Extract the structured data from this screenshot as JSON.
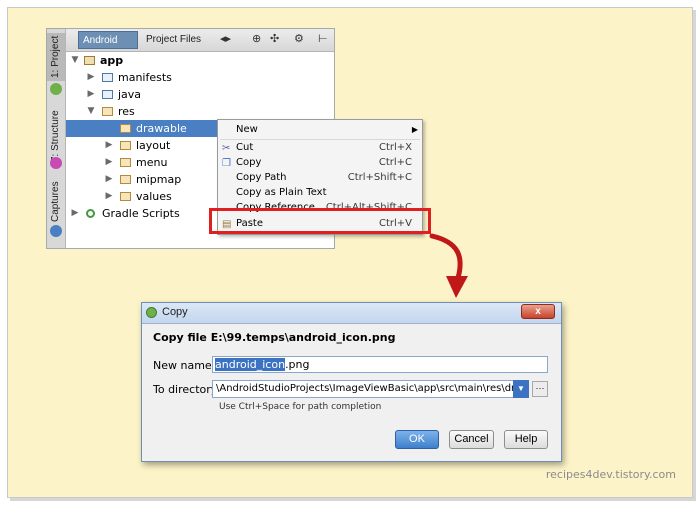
{
  "ide": {
    "vtabs": [
      "1: Project",
      "7: Structure",
      "Captures"
    ],
    "toolbar_tabs": [
      "Android",
      "Project Files"
    ],
    "tree": [
      {
        "label": "app",
        "bold": true
      },
      {
        "label": "manifests"
      },
      {
        "label": "java"
      },
      {
        "label": "res"
      },
      {
        "label": "drawable",
        "selected": true
      },
      {
        "label": "layout"
      },
      {
        "label": "menu"
      },
      {
        "label": "mipmap"
      },
      {
        "label": "values"
      },
      {
        "label": "Gradle Scripts"
      }
    ]
  },
  "context_menu": [
    {
      "label": "New",
      "shortcut": ""
    },
    {
      "label": "Cut",
      "shortcut": "Ctrl+X"
    },
    {
      "label": "Copy",
      "shortcut": "Ctrl+C"
    },
    {
      "label": "Copy Path",
      "shortcut": "Ctrl+Shift+C"
    },
    {
      "label": "Copy as Plain Text",
      "shortcut": ""
    },
    {
      "label": "Copy Reference",
      "shortcut": "Ctrl+Alt+Shift+C"
    },
    {
      "label": "Paste",
      "shortcut": "Ctrl+V"
    }
  ],
  "dialog": {
    "title": "Copy",
    "heading": "Copy file E:\\99.temps\\android_icon.png",
    "new_name_label": "New name:",
    "new_name_selected": "android_icon",
    "new_name_rest": ".png",
    "dir_label": "To directory:",
    "dir_value": "\\AndroidStudioProjects\\ImageViewBasic\\app\\src\\main\\res\\drawable",
    "hint": "Use Ctrl+Space for path completion",
    "ok": "OK",
    "cancel": "Cancel",
    "help": "Help",
    "close": "x"
  },
  "watermark": "recipes4dev.tistory.com",
  "colors": {
    "highlight": "#e02020",
    "selection": "#4a7fc3",
    "background": "#fdf3c8"
  }
}
